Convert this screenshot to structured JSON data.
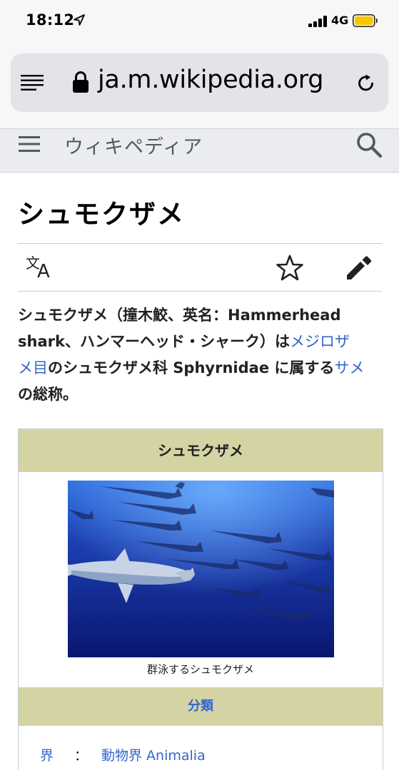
{
  "status_bar": {
    "time": "18:12",
    "network": "4G"
  },
  "browser": {
    "url": "ja.m.wikipedia.org"
  },
  "header": {
    "brand": "ウィキペディア"
  },
  "article": {
    "title": "シュモクザメ",
    "lead": {
      "line1_bold": "シュモクザメ",
      "line1_a": "（撞木鮫、英名：",
      "line1_bold2": "Hammerhead",
      "line2_bold": "shark",
      "line2_a": "、ハンマーヘッド・シャーク）は",
      "line2_link": "メジロザ",
      "line3_link": "メ目",
      "line3_a": "のシュモクザメ科 Sphyrnidae に属する",
      "line3_link2": "サメ",
      "line4_a": "の総称。"
    }
  },
  "infobox": {
    "title": "シュモクザメ",
    "image_caption": "群泳するシュモクザメ",
    "section_label": "分類",
    "rows": [
      {
        "rank": "界",
        "colon": "：",
        "value": "動物界 Animalia"
      }
    ]
  },
  "colors": {
    "link": "#3366cc",
    "infobox_header": "#d3d3a4",
    "header_bg": "#eaecf0"
  }
}
